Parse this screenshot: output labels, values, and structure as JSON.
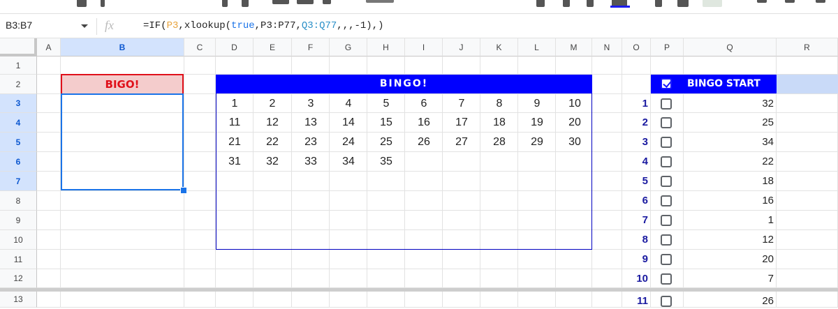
{
  "toolbar": {
    "visible": true
  },
  "formula_bar": {
    "name_box": "B3:B7",
    "fx_label": "fx",
    "formula_parts": [
      "=IF(",
      "P3",
      ",xlookup(",
      "true",
      ",P3:P77,",
      "Q3:Q77",
      ",,,-1),)"
    ]
  },
  "columns": [
    "A",
    "B",
    "C",
    "D",
    "E",
    "F",
    "G",
    "H",
    "I",
    "J",
    "K",
    "L",
    "M",
    "N",
    "O",
    "P",
    "Q",
    "R"
  ],
  "rows": [
    "1",
    "2",
    "3",
    "4",
    "5",
    "6",
    "7",
    "8",
    "9",
    "10",
    "11",
    "12",
    "13"
  ],
  "bigo": {
    "label": "BIGO!"
  },
  "bingo": {
    "title": "BINGO!",
    "numbers": [
      [
        "1",
        "2",
        "3",
        "4",
        "5",
        "6",
        "7",
        "8",
        "9",
        "10"
      ],
      [
        "11",
        "12",
        "13",
        "14",
        "15",
        "16",
        "17",
        "18",
        "19",
        "20"
      ],
      [
        "21",
        "22",
        "23",
        "24",
        "25",
        "26",
        "27",
        "28",
        "29",
        "30"
      ],
      [
        "31",
        "32",
        "33",
        "34",
        "35",
        "",
        "",
        "",
        "",
        ""
      ]
    ]
  },
  "start": {
    "label": "BINGO START",
    "rows": [
      {
        "n": "1",
        "v": "32"
      },
      {
        "n": "2",
        "v": "25"
      },
      {
        "n": "3",
        "v": "34"
      },
      {
        "n": "4",
        "v": "22"
      },
      {
        "n": "5",
        "v": "18"
      },
      {
        "n": "6",
        "v": "16"
      },
      {
        "n": "7",
        "v": "1"
      },
      {
        "n": "8",
        "v": "12"
      },
      {
        "n": "9",
        "v": "20"
      },
      {
        "n": "10",
        "v": "7"
      },
      {
        "n": "11",
        "v": "26"
      }
    ]
  },
  "colors": {
    "accent_blue": "#0000ff",
    "bigo_red": "#e0101a",
    "bigo_fill": "#f4cccc",
    "selection": "#1a73e8"
  }
}
